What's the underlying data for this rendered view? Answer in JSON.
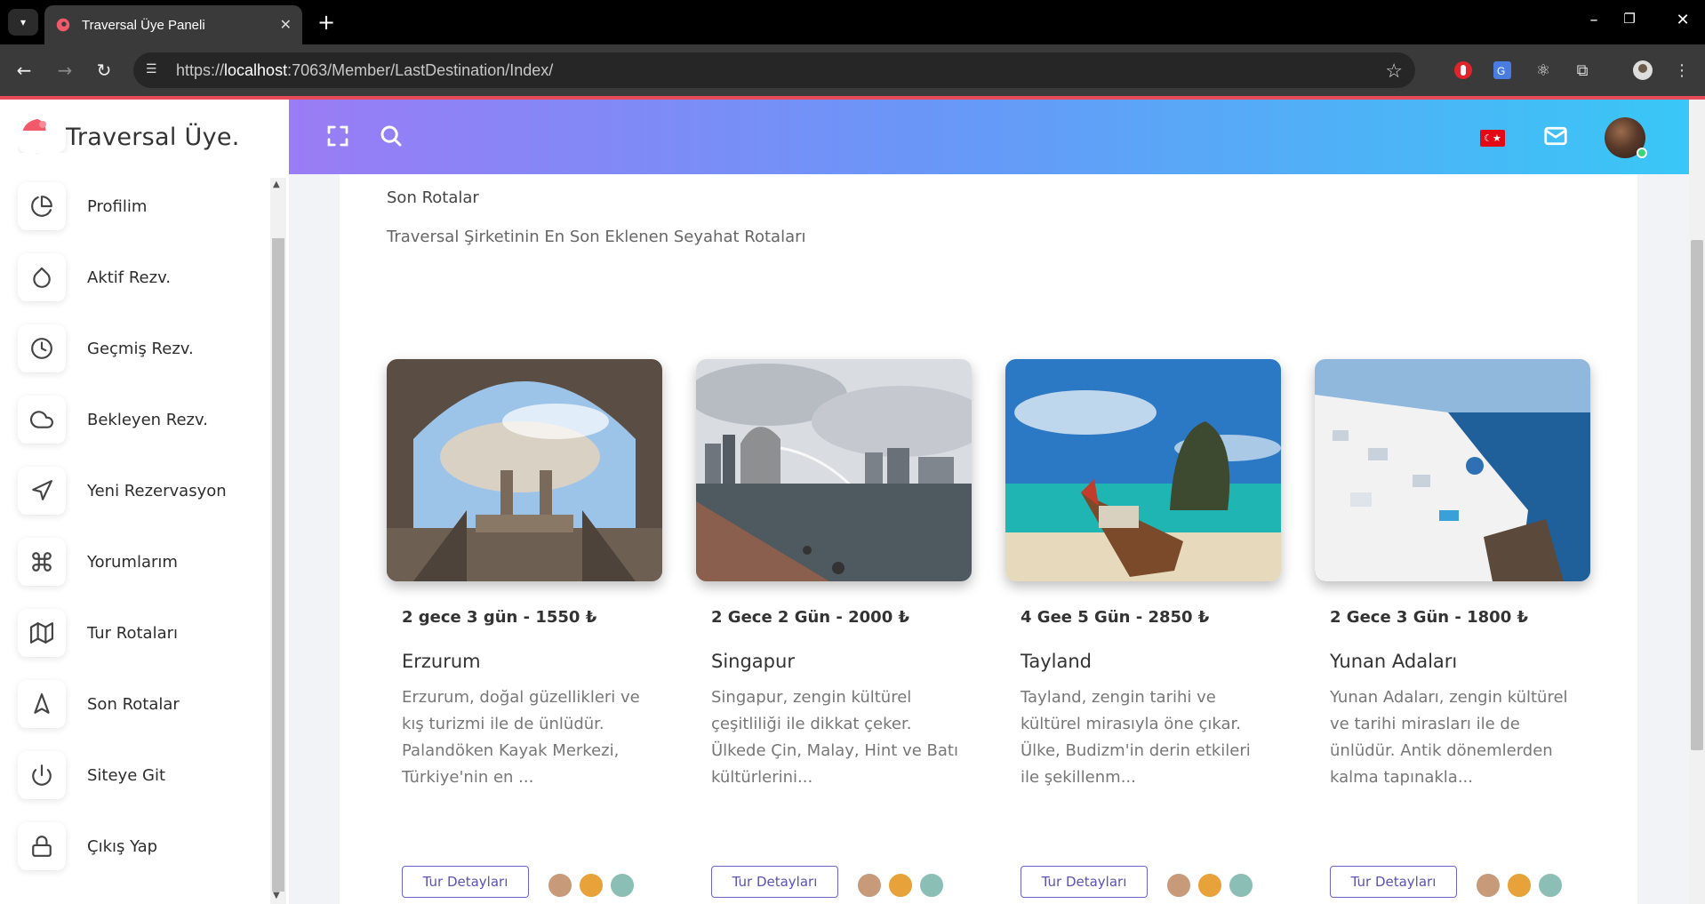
{
  "browser": {
    "tab_title": "Traversal Üye Paneli",
    "url_prefix": "https://",
    "url_host": "localhost",
    "url_rest": ":7063/Member/LastDestination/Index/"
  },
  "brand": {
    "name": "Traversal Üye."
  },
  "sidebar": {
    "items": [
      {
        "label": "Profilim",
        "icon": "pie-chart-icon"
      },
      {
        "label": "Aktif Rezv.",
        "icon": "droplet-icon"
      },
      {
        "label": "Geçmiş Rezv.",
        "icon": "clock-icon"
      },
      {
        "label": "Bekleyen Rezv.",
        "icon": "cloud-icon"
      },
      {
        "label": "Yeni Rezervasyon",
        "icon": "send-icon"
      },
      {
        "label": "Yorumlarım",
        "icon": "command-icon"
      },
      {
        "label": "Tur Rotaları",
        "icon": "map-icon"
      },
      {
        "label": "Son Rotalar",
        "icon": "navigation-icon"
      },
      {
        "label": "Siteye Git",
        "icon": "power-icon"
      },
      {
        "label": "Çıkış Yap",
        "icon": "lock-icon"
      }
    ]
  },
  "header": {
    "flag_symbol": "☾★"
  },
  "page": {
    "title": "Son Rotalar",
    "subtitle": "Traversal Şirketinin En Son Eklenen Seyahat Rotaları"
  },
  "tours": [
    {
      "price": "2 gece 3 gün - 1550 ₺",
      "name": "Erzurum",
      "desc": "Erzurum, doğal güzellikleri ve kış turizmi ile de ünlüdür. Palandöken Kayak Merkezi, Türkiye'nin en ...",
      "button": "Tur Detayları"
    },
    {
      "price": "2 Gece 2 Gün - 2000 ₺",
      "name": "Singapur",
      "desc": "Singapur, zengin kültürel çeşitliliği ile dikkat çeker. Ülkede Çin, Malay, Hint ve Batı kültürlerini...",
      "button": "Tur Detayları"
    },
    {
      "price": "4 Gee 5 Gün - 2850 ₺",
      "name": "Tayland",
      "desc": "Tayland, zengin tarihi ve kültürel mirasıyla öne çıkar. Ülke, Budizm'in derin etkileri ile şekillenm...",
      "button": "Tur Detayları"
    },
    {
      "price": "2 Gece 3 Gün - 1800 ₺",
      "name": "Yunan Adaları",
      "desc": "Yunan Adaları, zengin kültürel ve tarihi mirasları ile de ünlüdür. Antik dönemlerden kalma tapınakla...",
      "button": "Tur Detayları"
    }
  ]
}
